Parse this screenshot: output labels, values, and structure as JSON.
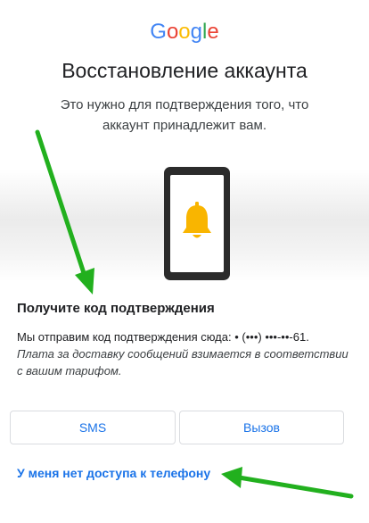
{
  "logo": {
    "letters": [
      "G",
      "o",
      "o",
      "g",
      "l",
      "e"
    ],
    "colors": [
      "#4285F4",
      "#EA4335",
      "#FBBC05",
      "#4285F4",
      "#34A853",
      "#EA4335"
    ]
  },
  "page": {
    "title": "Восстановление аккаунта",
    "subtitle": "Это нужно для подтверждения того, что аккаунт принадлежит вам."
  },
  "verification": {
    "heading": "Получите код подтверждения",
    "send_text": "Мы отправим код подтверждения сюда: • (•••) •••-••-61.",
    "fee_note": "Плата за доставку сообщений взимается в соответствии с вашим тарифом."
  },
  "actions": {
    "sms_label": "SMS",
    "call_label": "Вызов",
    "no_access_link": "У меня нет доступа к телефону"
  },
  "colors": {
    "accent": "#1a73e8",
    "arrow": "#22b01e",
    "bell": "#f9b500",
    "phone_body": "#2b2b2b"
  },
  "icons": {
    "illustration": "phone-with-bell-icon",
    "annotation": "green-arrow-icon"
  }
}
